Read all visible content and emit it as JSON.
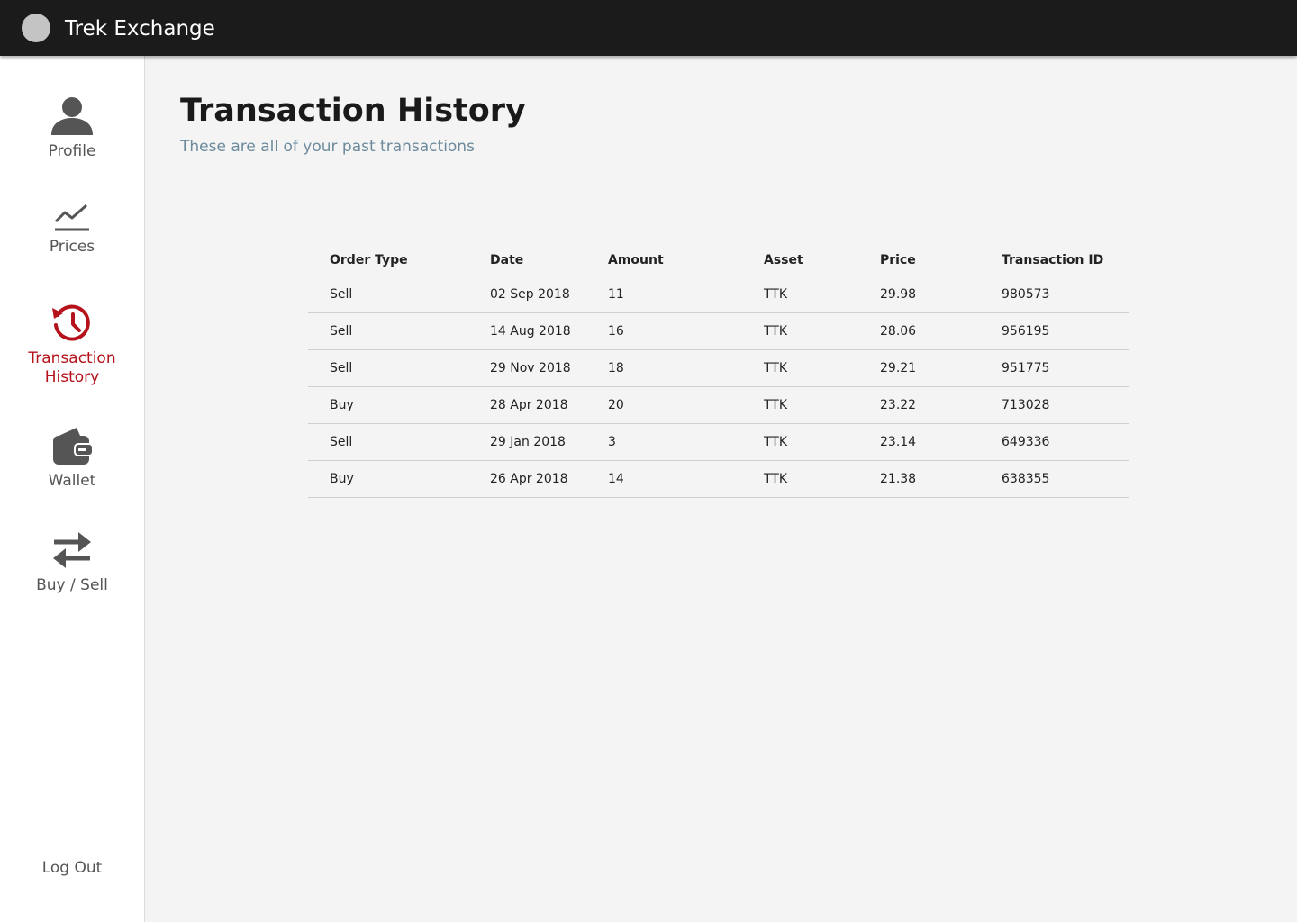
{
  "app": {
    "title": "Trek Exchange"
  },
  "sidebar": {
    "items": [
      {
        "label": "Profile",
        "icon": "person-icon",
        "active": false
      },
      {
        "label": "Prices",
        "icon": "chart-line-icon",
        "active": false
      },
      {
        "label": "Transaction History",
        "icon": "history-icon",
        "active": true
      },
      {
        "label": "Wallet",
        "icon": "wallet-icon",
        "active": false
      },
      {
        "label": "Buy / Sell",
        "icon": "swap-arrows-icon",
        "active": false
      }
    ],
    "logout_label": "Log Out"
  },
  "page": {
    "title": "Transaction History",
    "subtitle": "These are all of your past transactions"
  },
  "table": {
    "columns": [
      "Order Type",
      "Date",
      "Amount",
      "Asset",
      "Price",
      "Transaction ID"
    ],
    "rows": [
      [
        "Sell",
        "02 Sep 2018",
        "11",
        "TTK",
        "29.98",
        "980573"
      ],
      [
        "Sell",
        "14 Aug 2018",
        "16",
        "TTK",
        "28.06",
        "956195"
      ],
      [
        "Sell",
        "29 Nov 2018",
        "18",
        "TTK",
        "29.21",
        "951775"
      ],
      [
        "Buy",
        "28 Apr 2018",
        "20",
        "TTK",
        "23.22",
        "713028"
      ],
      [
        "Sell",
        "29 Jan 2018",
        "3",
        "TTK",
        "23.14",
        "649336"
      ],
      [
        "Buy",
        "26 Apr 2018",
        "14",
        "TTK",
        "21.38",
        "638355"
      ]
    ]
  },
  "colors": {
    "topbar": "#1b1b1b",
    "accent_active": "#b5121b",
    "subtitle": "#6c8a9b",
    "icon_gray": "#555555"
  }
}
